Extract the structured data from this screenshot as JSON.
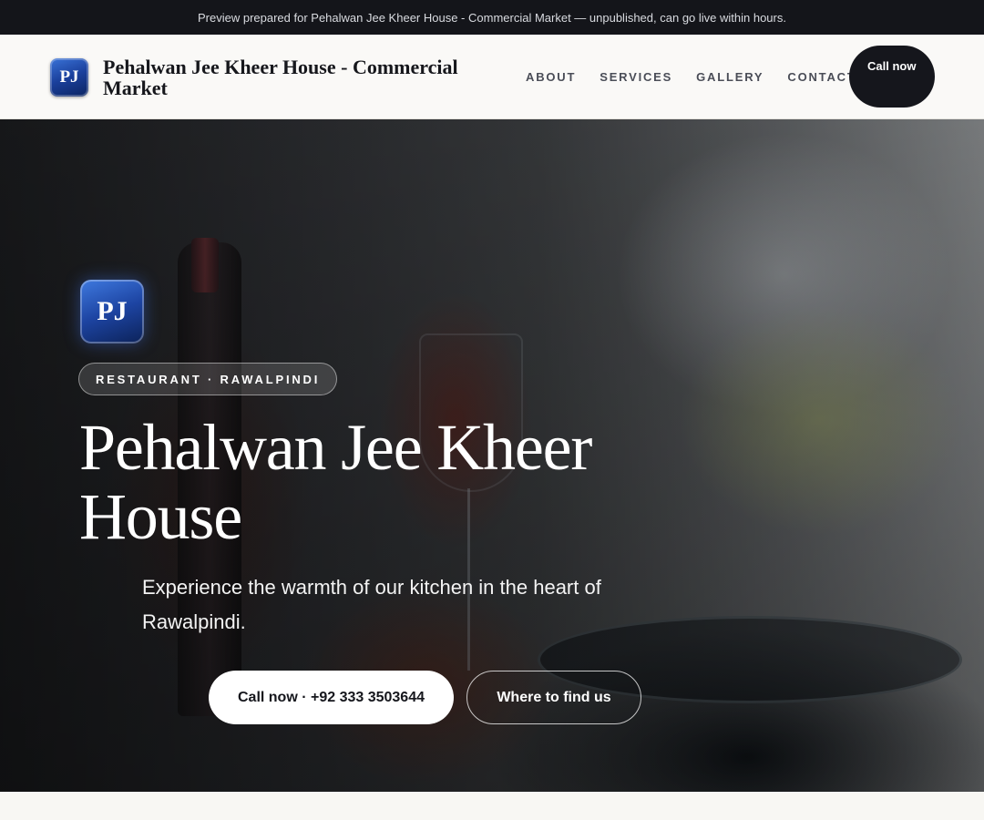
{
  "banner": {
    "text": "Preview prepared for Pehalwan Jee Kheer House - Commercial Market — unpublished, can go live within hours."
  },
  "header": {
    "logo_initials": "PJ",
    "brand_name": "Pehalwan Jee Kheer House - Commercial Market",
    "nav": [
      {
        "label": "ABOUT"
      },
      {
        "label": "SERVICES"
      },
      {
        "label": "GALLERY"
      },
      {
        "label": "CONTACT"
      }
    ],
    "call_label": "Call now"
  },
  "hero": {
    "logo_initials": "PJ",
    "chip": "RESTAURANT · RAWALPINDI",
    "title": "Pehalwan Jee Kheer House",
    "subtitle": "Experience the warmth of our kitchen in the heart of Rawalpindi.",
    "primary_cta": "Call now · +92 333 3503644",
    "secondary_cta": "Where to find us",
    "background_image": "restaurant table with wine glasses, bottle and plate (blurred)"
  },
  "colors": {
    "banner_bg": "#14151a",
    "dark_button": "#15161c",
    "logo_blue": "#1a3f9b",
    "page_bg": "#f8f7f3"
  }
}
